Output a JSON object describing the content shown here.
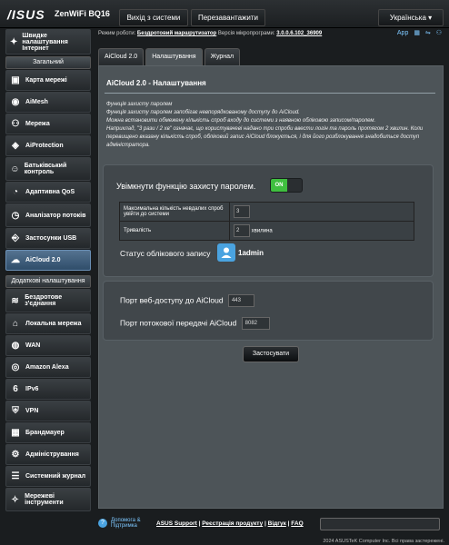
{
  "header": {
    "logo": "/ISUS",
    "model": "ZenWiFi BQ16",
    "logout": "Вихід з системи",
    "reboot": "Перезавантажити",
    "language": "Українська"
  },
  "status": {
    "mode_label": "Режим роботи:",
    "mode_value": "Бездротовий маршрутизатор",
    "fw_label": "Версія мікропрограми:",
    "fw_value": "3.0.0.6.102_36909",
    "app_label": "App"
  },
  "sidebar": {
    "quick": "Швидке налаштування Інтернет",
    "general_header": "Загальний",
    "general_items": [
      "Карта мережі",
      "AiMesh",
      "Мережа",
      "AiProtection",
      "Батьківський контроль",
      "Адаптивна QoS",
      "Аналізатор потоків",
      "Застосунки USB",
      "AiCloud 2.0"
    ],
    "advanced_header": "Додаткові налаштування",
    "advanced_items": [
      "Бездротове з'єднання",
      "Локальна мережа",
      "WAN",
      "Amazon Alexa",
      "IPv6",
      "VPN",
      "Брандмауер",
      "Адміністрування",
      "Системний журнал",
      "Мережеві інструменти"
    ]
  },
  "tabs": [
    "AiCloud 2.0",
    "Налаштування",
    "Журнал"
  ],
  "panel": {
    "title": "AiCloud 2.0 - Налаштування",
    "desc1": "Функція захисту паролем",
    "desc2": "Функція захисту паролем запобігає невпорядкованому доступу до AiCloud.",
    "desc3": "Можна встановити обмежену кількість спроб входу до системи з наявною обліковою записом/паролем.",
    "desc4": "Наприклад, \"3 рази / 2 хв\" означає, що користувачеві надано три спроби ввести логін та пароль протягом 2 хвилин. Коли перевищено вказану кількість спроб, обліковий запис AiCloud блокується, і для його розблокування знадобиться доступ адміністратора.",
    "toggle_label": "Увімкнути функцію захисту паролем.",
    "toggle_state": "ON",
    "max_attempts_label": "Максимальна кількість невдалих спроб увійти до системи",
    "max_attempts_value": "3",
    "duration_label": "Тривалість",
    "duration_value": "2",
    "duration_unit": "хвилина",
    "account_status_label": "Статус облікового запису",
    "account_user": "1admin",
    "web_port_label": "Порт веб-доступу до AiCloud",
    "web_port_value": "443",
    "stream_port_label": "Порт потокової передачі AiCloud",
    "stream_port_value": "8082",
    "apply_label": "Застосувати"
  },
  "footer": {
    "help": "Допомога & Підтримка",
    "links": [
      "ASUS Support",
      "Реєстрація продукту",
      "Відгук",
      "FAQ"
    ],
    "copyright": "2024 ASUSTeK Computer Inc. Всі права застережені."
  },
  "colors": {
    "accent": "#3fbf3f",
    "link": "#7ec8ff",
    "active_nav": "#4b6b8a"
  }
}
